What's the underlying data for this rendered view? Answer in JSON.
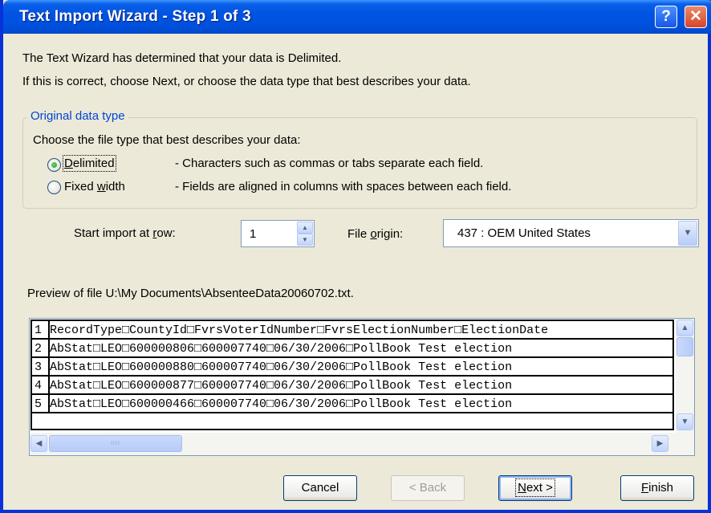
{
  "window": {
    "title": "Text Import Wizard - Step 1 of 3",
    "help_glyph": "?",
    "close_glyph": "✕"
  },
  "intro": {
    "line1": "The Text Wizard has determined that your data is Delimited.",
    "line2": "If this is correct, choose Next, or choose the data type that best describes your data."
  },
  "data_type": {
    "group_label": "Original data type",
    "prompt": "Choose the file type that best describes your data:",
    "options": [
      {
        "label_pre": "",
        "label_key": "D",
        "label_post": "elimited",
        "description": "- Characters such as commas or tabs separate each field.",
        "selected": true
      },
      {
        "label_pre": "Fixed ",
        "label_key": "w",
        "label_post": "idth",
        "description": "- Fields are aligned in columns with spaces between each field.",
        "selected": false
      }
    ]
  },
  "start_row": {
    "label_pre": "Start import at ",
    "label_key": "r",
    "label_post": "ow:",
    "value": "1"
  },
  "file_origin": {
    "label_pre": "File ",
    "label_key": "o",
    "label_post": "rigin:",
    "value": "437 : OEM United States"
  },
  "preview": {
    "label": "Preview of file U:\\My Documents\\AbsenteeData20060702.txt.",
    "rows": [
      {
        "num": "1",
        "text": "RecordType□CountyId□FvrsVoterIdNumber□FvrsElectionNumber□ElectionDate"
      },
      {
        "num": "2",
        "text": "AbStat□LEO□600000806□600007740□06/30/2006□PollBook Test election"
      },
      {
        "num": "3",
        "text": "AbStat□LEO□600000880□600007740□06/30/2006□PollBook Test election"
      },
      {
        "num": "4",
        "text": "AbStat□LEO□600000877□600007740□06/30/2006□PollBook Test election"
      },
      {
        "num": "5",
        "text": "AbStat□LEO□600000466□600007740□06/30/2006□PollBook Test election"
      }
    ]
  },
  "buttons": {
    "cancel": "Cancel",
    "back": "< Back",
    "next_key": "N",
    "next_rest": "ext >",
    "finish_key": "F",
    "finish_rest": "inish"
  },
  "colors": {
    "title_bar": "#0054E3",
    "group_label": "#0046D5",
    "dialog_bg": "#ECE9D8"
  },
  "icons": {
    "spin_up": "▲",
    "spin_down": "▼",
    "dropdown": "▼",
    "scroll_up": "▲",
    "scroll_down": "▼",
    "scroll_left": "◀",
    "scroll_right": "▶",
    "grip": "IIII"
  }
}
